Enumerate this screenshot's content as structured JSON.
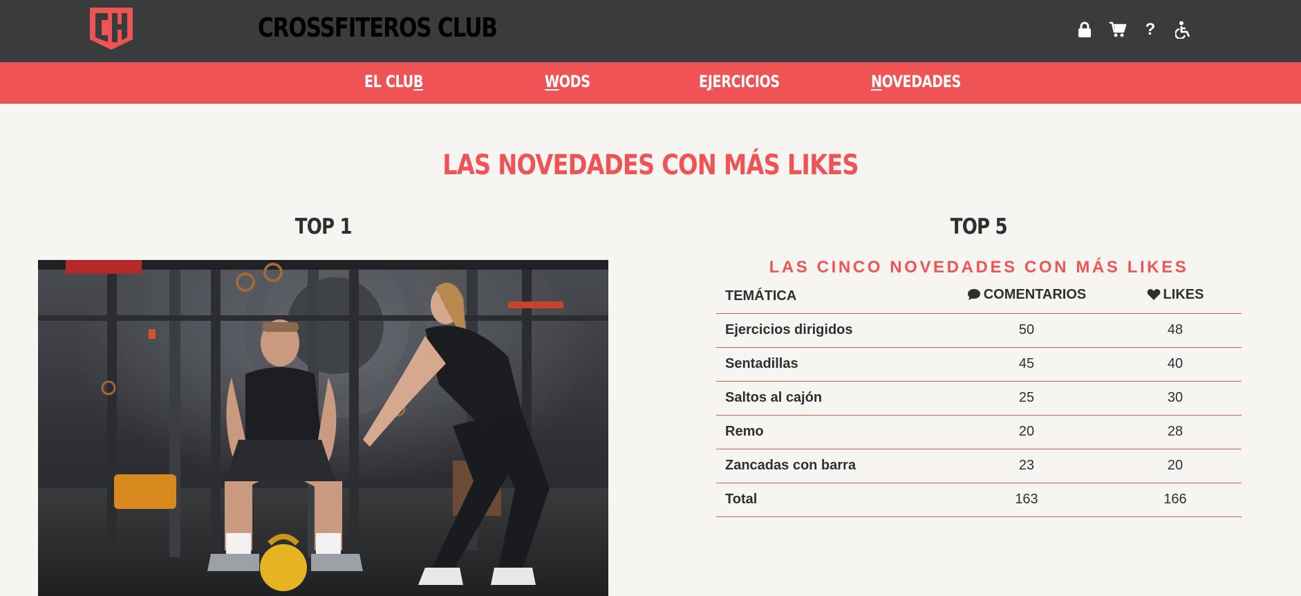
{
  "header": {
    "site_title": "CROSSFITEROS CLUB",
    "logo": "ch-shield-logo",
    "icons": [
      "lock-icon",
      "cart-icon",
      "help-icon",
      "accessibility-icon"
    ],
    "help_glyph": "?"
  },
  "nav": {
    "items": [
      {
        "pre": "EL CLU",
        "ul": "B",
        "post": ""
      },
      {
        "pre": "",
        "ul": "W",
        "post": "ODS"
      },
      {
        "pre": "E",
        "ul": "J",
        "post": "ERCICIOS"
      },
      {
        "pre": "",
        "ul": "N",
        "post": "OVEDADES"
      }
    ]
  },
  "main": {
    "heading": "LAS NOVEDADES CON MÁS LIKES",
    "top1": {
      "heading": "TOP 1"
    },
    "top5": {
      "heading": "TOP 5",
      "caption": "LAS CINCO NOVEDADES CON MÁS LIKES",
      "columns": [
        "TEMÁTICA",
        "COMENTARIOS",
        "LIKES"
      ],
      "rows": [
        {
          "topic": "Ejercicios dirigidos",
          "comments": "50",
          "likes": "48"
        },
        {
          "topic": "Sentadillas",
          "comments": "45",
          "likes": "40"
        },
        {
          "topic": "Saltos al cajón",
          "comments": "25",
          "likes": "30"
        },
        {
          "topic": "Remo",
          "comments": "20",
          "likes": "28"
        },
        {
          "topic": "Zancadas con barra",
          "comments": "23",
          "likes": "20"
        },
        {
          "topic": "Total",
          "comments": "163",
          "likes": "166"
        }
      ]
    }
  },
  "colors": {
    "header_bg": "#3a3b3c",
    "accent": "#ee5455",
    "page_bg": "#f7f5f2",
    "text": "#2f2f2f"
  }
}
